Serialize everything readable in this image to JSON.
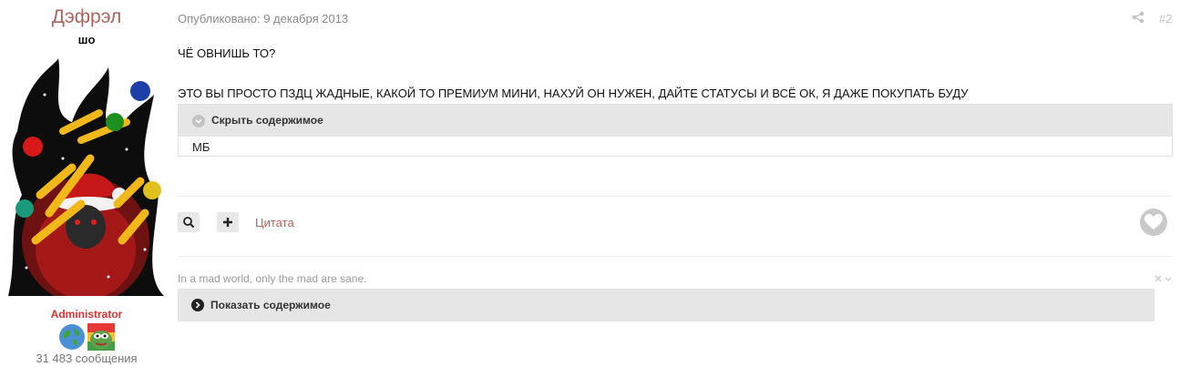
{
  "author": {
    "name": "Дэфрэл",
    "title": "шо",
    "group": "Administrator",
    "posts": "31 483 сообщения",
    "badges": [
      "globe-badge-icon",
      "pepe-badge-icon"
    ]
  },
  "post": {
    "meta": "Опубликовано: 9 декабря 2013",
    "number": "#2",
    "line1": "ЧЁ ОВНИШЬ ТО?",
    "line2": "ЭТО ВЫ ПРОСТО ПЗДЦ ЖАДНЫЕ, КАКОЙ ТО ПРЕМИУМ МИНИ, НАХУЙ ОН НУЖЕН, ДАЙТЕ СТАТУСЫ И ВСЁ ОК, Я ДАЖЕ ПОКУПАТЬ БУДУ",
    "spoiler": {
      "label": "Скрыть содержимое",
      "content": "МБ"
    }
  },
  "actions": {
    "search_icon": "search-icon",
    "add_icon": "plus-icon",
    "quote": "Цитата",
    "like_icon": "heart-icon"
  },
  "signature": {
    "text": "In a mad world, only the mad are sane.",
    "spoiler_label": "Показать содержимое"
  },
  "colors": {
    "author_name": "#b0625c",
    "group": "#e03030",
    "link": "#b0625c",
    "spoiler_bg": "#e6e6e6"
  }
}
